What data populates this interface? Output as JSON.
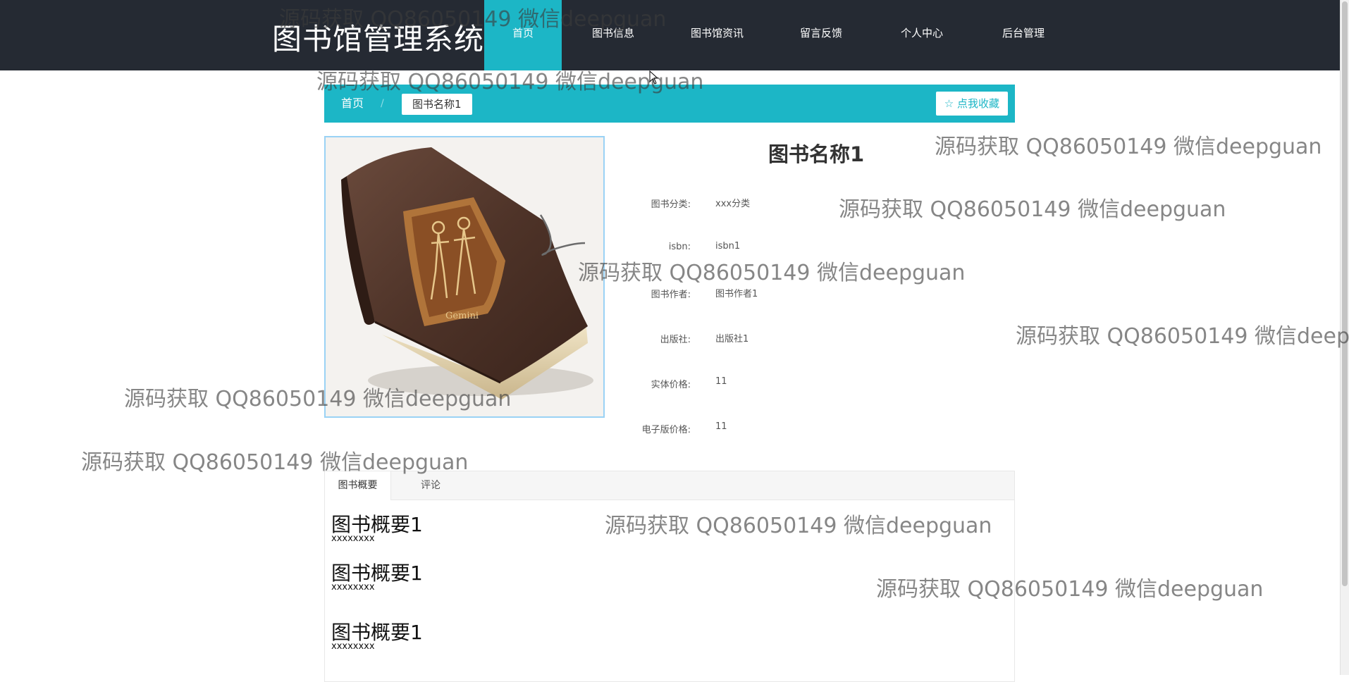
{
  "nav": {
    "brand": "图书馆管理系统",
    "items": [
      "首页",
      "图书信息",
      "图书馆资讯",
      "留言反馈",
      "个人中心",
      "后台管理"
    ]
  },
  "breadcrumb": {
    "home": "首页",
    "separator": "/",
    "current": "图书名称1",
    "favorite": "☆ 点我收藏"
  },
  "book": {
    "title": "图书名称1",
    "fields": [
      {
        "label": "图书分类:",
        "value": "xxx分类"
      },
      {
        "label": "isbn:",
        "value": "isbn1"
      },
      {
        "label": "图书作者:",
        "value": "图书作者1"
      },
      {
        "label": "出版社:",
        "value": "出版社1"
      },
      {
        "label": "实体价格:",
        "value": "11"
      },
      {
        "label": "电子版价格:",
        "value": "11"
      }
    ],
    "cover_text": "Gemini"
  },
  "tabs": {
    "items": [
      "图书概要",
      "评论"
    ],
    "summaries": [
      {
        "title": "图书概要1",
        "sub": "xxxxxxxx"
      },
      {
        "title": "图书概要1",
        "sub": "xxxxxxxx"
      },
      {
        "title": "图书概要1",
        "sub": "xxxxxxxx"
      }
    ]
  },
  "watermark": "源码获取 QQ86050149 微信deepguan",
  "colors": {
    "accent": "#1cb6c6",
    "nav_bg": "#252a33"
  }
}
